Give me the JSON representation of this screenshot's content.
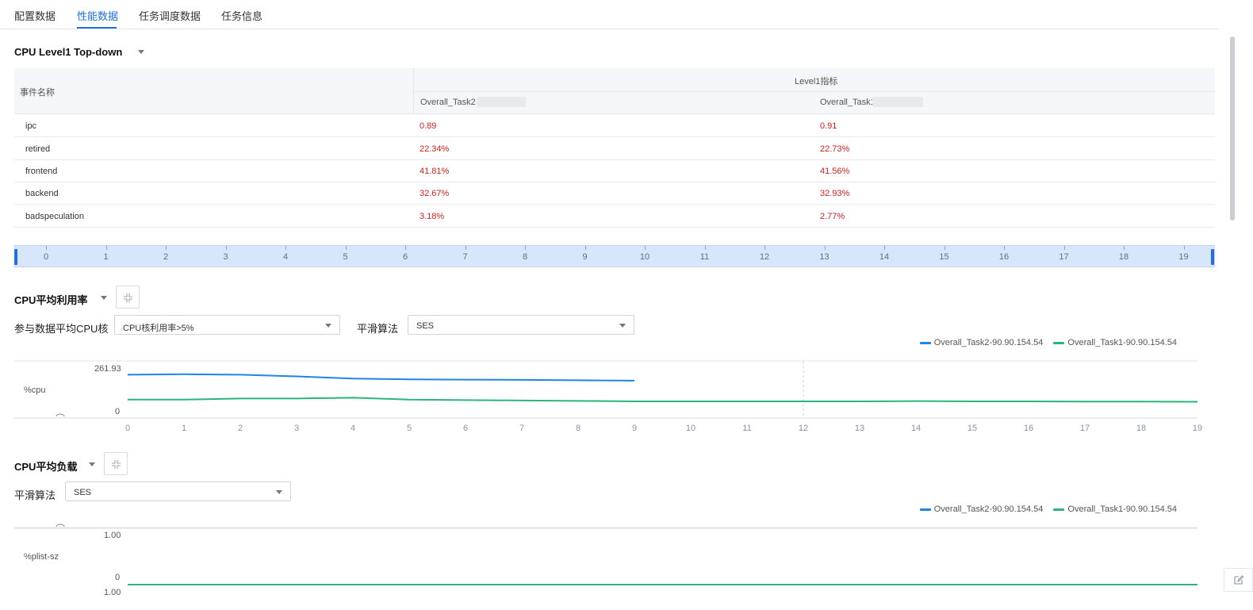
{
  "tabs": [
    {
      "label": "配置数据",
      "active": false
    },
    {
      "label": "性能数据",
      "active": true
    },
    {
      "label": "任务调度数据",
      "active": false
    },
    {
      "label": "任务信息",
      "active": false
    }
  ],
  "topdown": {
    "title": "CPU Level1 Top-down",
    "col_event": "事件名称",
    "col_group": "Level1指标",
    "col_task2": "Overall_Task2",
    "col_task1": "Overall_Task1",
    "rows": [
      {
        "name": "ipc",
        "task2": "0.89",
        "task1": "0.91"
      },
      {
        "name": "retired",
        "task2": "22.34%",
        "task1": "22.73%"
      },
      {
        "name": "frontend",
        "task2": "41.81%",
        "task1": "41.56%"
      },
      {
        "name": "backend",
        "task2": "32.67%",
        "task1": "32.93%"
      },
      {
        "name": "badspeculation",
        "task2": "3.18%",
        "task1": "2.77%"
      }
    ]
  },
  "timeline": {
    "ticks": [
      "0",
      "1",
      "2",
      "3",
      "4",
      "5",
      "6",
      "7",
      "8",
      "9",
      "10",
      "11",
      "12",
      "13",
      "14",
      "15",
      "16",
      "17",
      "18",
      "19"
    ]
  },
  "cpu_util": {
    "title": "CPU平均利用率",
    "core_label": "参与数据平均CPU核",
    "core_value": "CPU核利用率>5%",
    "smooth_label": "平滑算法",
    "smooth_value": "SES",
    "y_unit": "%cpu",
    "y_max_label": "261.93",
    "y_min_label": "0",
    "legend": [
      "Overall_Task2-90.90.154.54",
      "Overall_Task1-90.90.154.54"
    ]
  },
  "cpu_load": {
    "title": "CPU平均负载",
    "smooth_label": "平滑算法",
    "smooth_value": "SES",
    "y_unit": "%plist-sz",
    "y_max_label": "1.00",
    "y_zero_label": "0",
    "y_min_label": "1.00",
    "legend": [
      "Overall_Task2-90.90.154.54",
      "Overall_Task1-90.90.154.54"
    ]
  },
  "colors": {
    "accent": "#1f6fe5",
    "series_task2": "#1f84e8",
    "series_task1": "#2bb57a",
    "value_red": "#d21f1f"
  },
  "chart_data": [
    {
      "type": "line",
      "title": "CPU平均利用率",
      "ylabel": "%cpu",
      "ylim": [
        0,
        261.93
      ],
      "xlim": [
        0,
        19
      ],
      "x": [
        0,
        1,
        2,
        3,
        4,
        5,
        6,
        7,
        8,
        9,
        10,
        11,
        12,
        13,
        14,
        15,
        16,
        17,
        18,
        19
      ],
      "series": [
        {
          "name": "Overall_Task2-90.90.154.54",
          "values": [
            198,
            200,
            198,
            190,
            180,
            176,
            175,
            174,
            172,
            170,
            null,
            null,
            null,
            null,
            null,
            null,
            null,
            null,
            null,
            null
          ]
        },
        {
          "name": "Overall_Task1-90.90.154.54",
          "values": [
            82,
            82,
            87,
            87,
            91,
            82,
            80,
            78,
            76,
            74,
            74,
            74,
            74,
            74,
            75,
            74,
            74,
            73,
            73,
            72
          ]
        }
      ],
      "grid": true,
      "legend": "top-right"
    },
    {
      "type": "line",
      "title": "CPU平均负载",
      "ylabel": "%plist-sz",
      "ylim": [
        -1,
        1
      ],
      "xlim": [
        0,
        19
      ],
      "x": [
        0,
        1,
        2,
        3,
        4,
        5,
        6,
        7,
        8,
        9,
        10,
        11,
        12,
        13,
        14,
        15,
        16,
        17,
        18,
        19
      ],
      "series": [
        {
          "name": "Overall_Task2-90.90.154.54",
          "values": []
        },
        {
          "name": "Overall_Task1-90.90.154.54",
          "values": [
            -1,
            -1,
            -1,
            -1,
            -1,
            -1,
            -1,
            -1,
            -1,
            -1,
            -1,
            -1,
            -1,
            -1,
            -1,
            -1,
            -1,
            -1,
            -1,
            -1
          ]
        }
      ],
      "grid": true,
      "legend": "top-right"
    }
  ]
}
